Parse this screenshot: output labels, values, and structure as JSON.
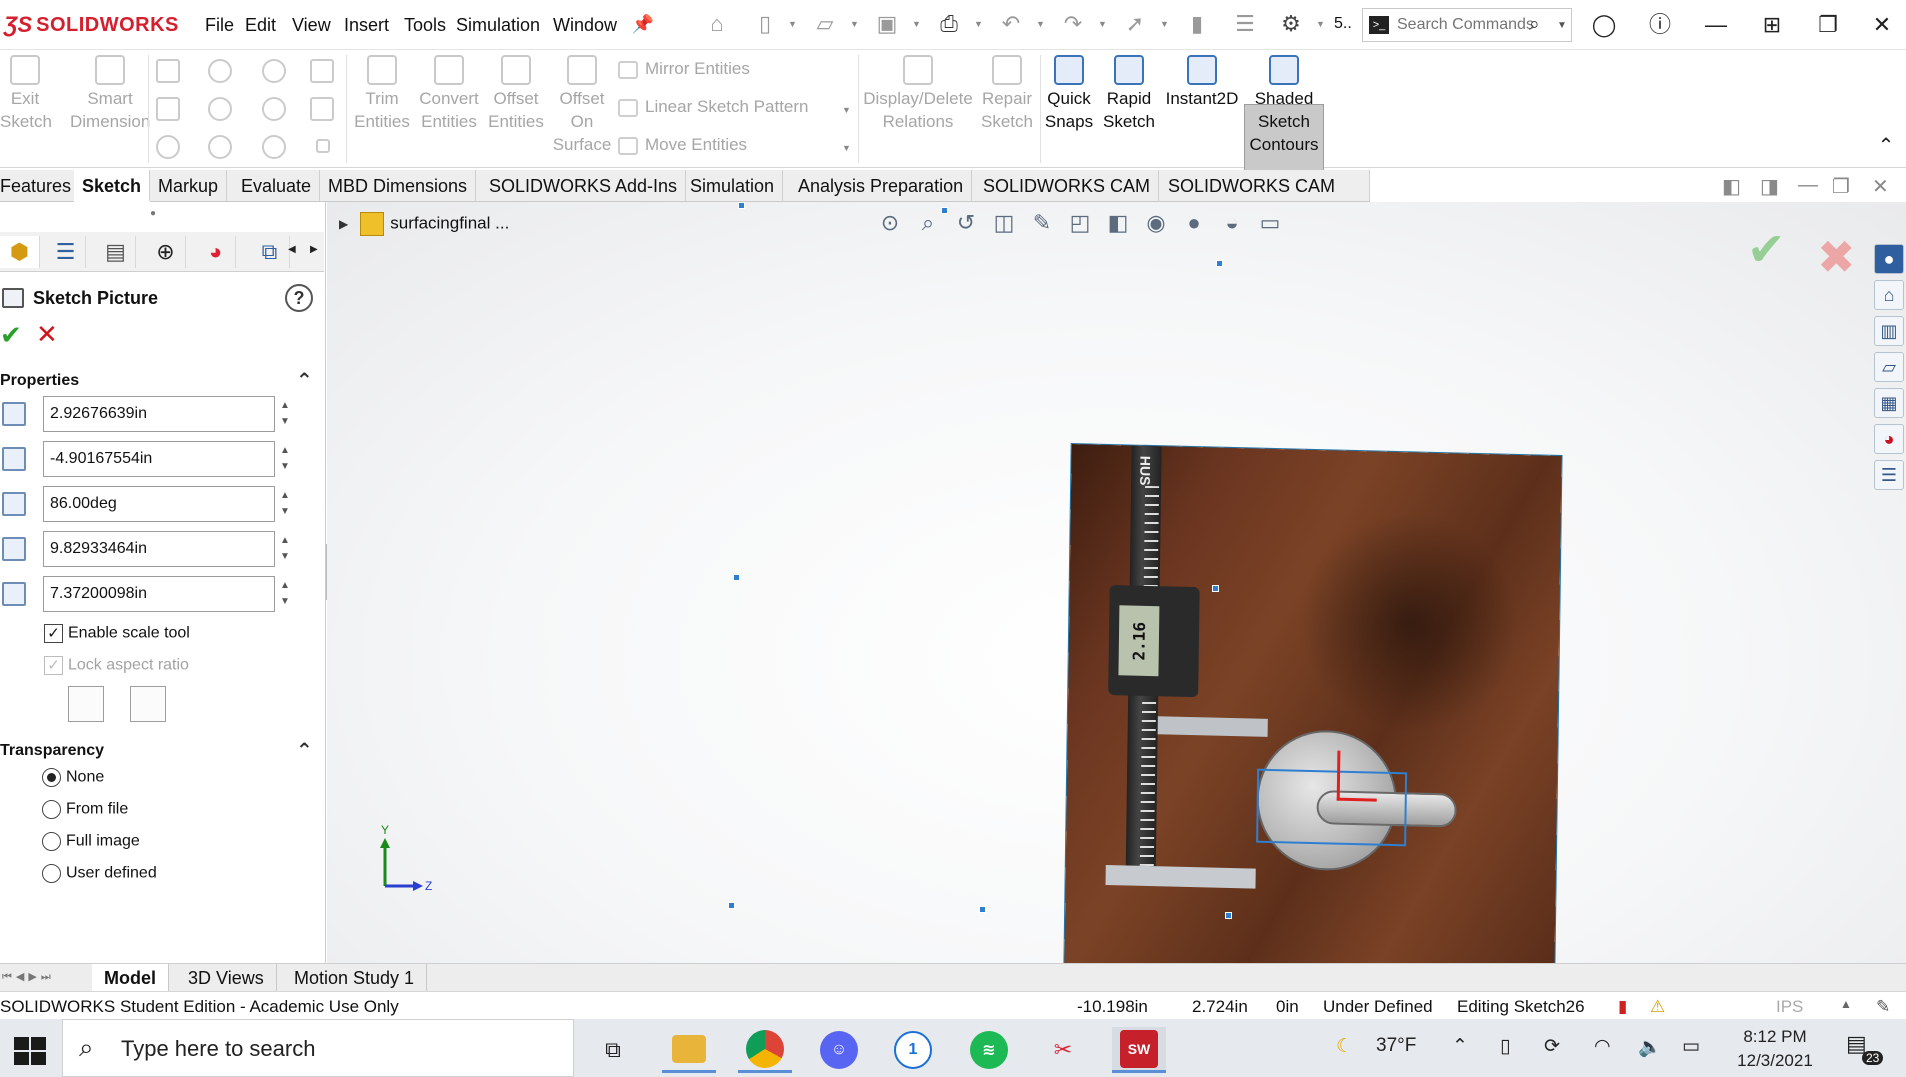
{
  "app": {
    "brand": "SOLIDWORKS",
    "menu": [
      "File",
      "Edit",
      "View",
      "Insert",
      "Tools",
      "Simulation",
      "Window"
    ],
    "search_placeholder": "Search Commands",
    "overflow_label": "5.."
  },
  "ribbon": {
    "exit_sketch": "Exit Sketch",
    "smart_dimension": "Smart Dimension",
    "trim_entities": "Trim Entities",
    "convert_entities": "Convert Entities",
    "offset_entities": "Offset Entities",
    "offset_on_surface": "Offset On Surface",
    "mirror_entities": "Mirror Entities",
    "linear_sketch_pattern": "Linear Sketch Pattern",
    "move_entities": "Move Entities",
    "display_delete_relations": "Display/Delete Relations",
    "repair_sketch": "Repair Sketch",
    "quick_snaps": "Quick Snaps",
    "rapid_sketch": "Rapid Sketch",
    "instant2d": "Instant2D",
    "shaded_sketch_contours": "Shaded Sketch Contours"
  },
  "tabs": [
    "Features",
    "Sketch",
    "Markup",
    "Evaluate",
    "MBD Dimensions",
    "SOLIDWORKS Add-Ins",
    "Simulation",
    "Analysis Preparation",
    "SOLIDWORKS CAM",
    "SOLIDWORKS CAM TBM"
  ],
  "active_tab": "Sketch",
  "property_manager": {
    "title": "Sketch Picture",
    "properties_label": "Properties",
    "values": [
      "2.92676639in",
      "-4.90167554in",
      "86.00deg",
      "9.82933464in",
      "7.37200098in"
    ],
    "enable_scale_tool": "Enable scale tool",
    "lock_aspect_ratio": "Lock aspect ratio",
    "transparency_label": "Transparency",
    "transparency_options": [
      "None",
      "From file",
      "Full image",
      "User defined"
    ],
    "transparency_selected": "None"
  },
  "graphics": {
    "tree_item": "surfacingfinal ...",
    "caliper_reading": "2.16",
    "caliper_brand": "HUS",
    "triad_y": "Y",
    "triad_z": "Z"
  },
  "model_tabs": [
    "Model",
    "3D Views",
    "Motion Study 1"
  ],
  "status": {
    "edition": "SOLIDWORKS Student Edition - Academic Use Only",
    "x": "-10.198in",
    "y": "2.724in",
    "z": "0in",
    "state": "Under Defined",
    "editing": "Editing Sketch26",
    "units": "IPS"
  },
  "taskbar": {
    "search_placeholder": "Type here to search",
    "weather": "37°F",
    "time": "8:12 PM",
    "date": "12/3/2021",
    "notifications": "23"
  },
  "colors": {
    "brand_red": "#d4202e",
    "selection_blue": "#2f7fd0",
    "accept_green": "#2aa12a",
    "cancel_red": "#d0141c"
  }
}
